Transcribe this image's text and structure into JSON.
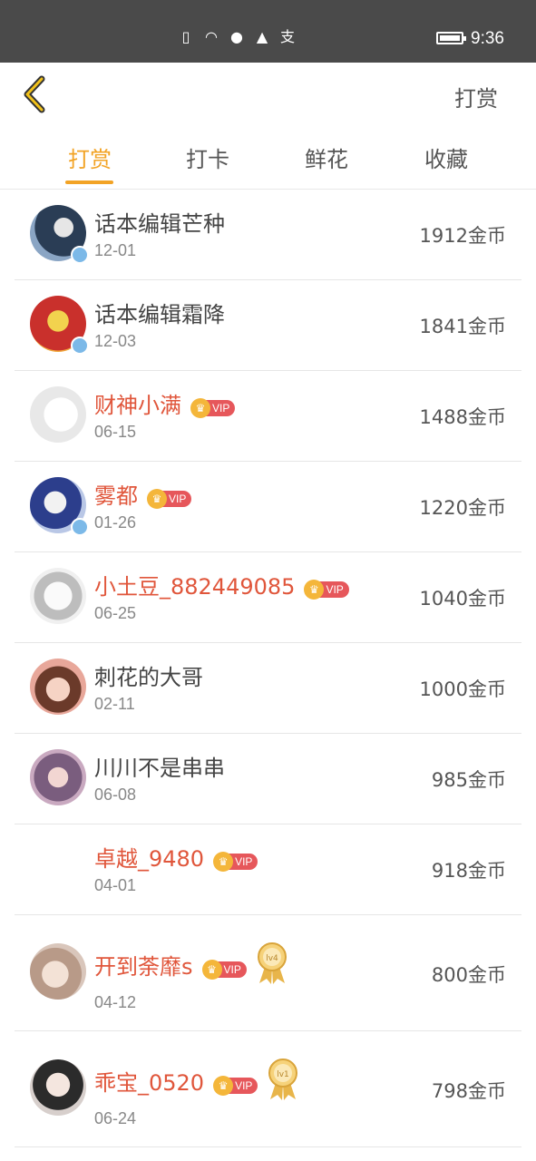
{
  "status_bar": {
    "time": "9:36",
    "icons": [
      "sim-alert-icon",
      "wifi-icon",
      "wechat-icon",
      "qq-icon",
      "alipay-icon"
    ]
  },
  "header": {
    "action_label": "打赏"
  },
  "tabs": [
    {
      "label": "打赏",
      "active": true
    },
    {
      "label": "打卡",
      "active": false
    },
    {
      "label": "鲜花",
      "active": false
    },
    {
      "label": "收藏",
      "active": false
    }
  ],
  "colors": {
    "accent": "#f2a325",
    "vip_name": "#e0563b",
    "vip_tag": "#e6575b"
  },
  "vip_label": "VIP",
  "rows": [
    {
      "name": "话本编辑芒种",
      "date": "12-01",
      "coins": "1912金币",
      "vip": false,
      "badge": true,
      "medal": ""
    },
    {
      "name": "话本编辑霜降",
      "date": "12-03",
      "coins": "1841金币",
      "vip": false,
      "badge": true,
      "medal": ""
    },
    {
      "name": "财神小满",
      "date": "06-15",
      "coins": "1488金币",
      "vip": true,
      "badge": false,
      "medal": ""
    },
    {
      "name": "雾都",
      "date": "01-26",
      "coins": "1220金币",
      "vip": true,
      "badge": true,
      "medal": ""
    },
    {
      "name": "小土豆_882449085",
      "date": "06-25",
      "coins": "1040金币",
      "vip": true,
      "badge": false,
      "medal": ""
    },
    {
      "name": "刺花的大哥",
      "date": "02-11",
      "coins": "1000金币",
      "vip": false,
      "badge": false,
      "medal": ""
    },
    {
      "name": "川川不是串串",
      "date": "06-08",
      "coins": "985金币",
      "vip": false,
      "badge": false,
      "medal": ""
    },
    {
      "name": "卓越_9480",
      "date": "04-01",
      "coins": "918金币",
      "vip": true,
      "badge": false,
      "medal": ""
    },
    {
      "name": "开到荼靡s",
      "date": "04-12",
      "coins": "800金币",
      "vip": true,
      "badge": false,
      "medal": "lv4"
    },
    {
      "name": "乖宝_0520",
      "date": "06-24",
      "coins": "798金币",
      "vip": true,
      "badge": false,
      "medal": "lv1"
    }
  ]
}
